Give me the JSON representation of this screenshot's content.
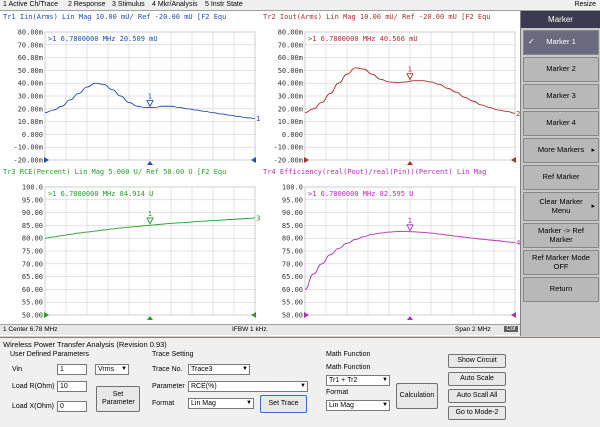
{
  "menu": {
    "items": [
      "1 Active Ch/Trace",
      "2 Response",
      "3 Stimulus",
      "4 Mkr/Analysis",
      "5 Instr State"
    ],
    "resize": "Resize"
  },
  "traces": [
    {
      "header": "Tr1 Iin(Arms) Lin Mag 10.00 mU/ Ref -20.00 mU [F2 Equ",
      "marker_text": ">1   6.7800000 MHz   20.509 mU",
      "color": "#1f4fa8",
      "yticks": [
        "80.00m",
        "70.00m",
        "60.00m",
        "50.00m",
        "40.00m",
        "30.00m",
        "20.00m",
        "10.00m",
        "0.000",
        "-10.00m",
        "-20.00m"
      ],
      "end_label": "1",
      "marker_label": "1",
      "values": [
        17,
        19,
        22,
        27,
        32,
        37,
        40,
        39,
        35,
        30,
        25,
        22,
        21,
        21,
        22,
        22,
        21,
        20,
        19,
        18,
        17,
        16,
        15,
        14,
        13,
        12.5
      ]
    },
    {
      "header": "Tr2 Iout(Arms) Lin Mag 10.00 mU/ Ref -20.00 mU [F2 Equ",
      "marker_text": ">1   6.7800000 MHz   40.566 mU",
      "color": "#a83030",
      "yticks": [
        "80.00m",
        "70.00m",
        "60.00m",
        "50.00m",
        "40.00m",
        "30.00m",
        "20.00m",
        "10.00m",
        "0.000",
        "-10.00m",
        "-20.00m"
      ],
      "end_label": "2",
      "marker_label": "1",
      "values": [
        17,
        20,
        25,
        32,
        40,
        47,
        52,
        51,
        47,
        43,
        41,
        40.5,
        41,
        42,
        42,
        41,
        39,
        36,
        33,
        29,
        26,
        23,
        21,
        19,
        18,
        16.5
      ]
    },
    {
      "header": "Tr3 RCE(Percent) Lin Mag 5.000 U/ Ref 50.00 U [F2 Equ",
      "marker_text": ">1   6.7800000 MHz   84.914 U",
      "color": "#2a9a2a",
      "yticks": [
        "100.0",
        "95.00",
        "90.00",
        "85.00",
        "80.00",
        "75.00",
        "70.00",
        "65.00",
        "60.00",
        "55.00",
        "50.00"
      ],
      "end_label": "3",
      "marker_label": "1",
      "values": [
        80,
        80.5,
        81,
        81.5,
        82,
        82.4,
        82.8,
        83.2,
        83.6,
        84,
        84.3,
        84.6,
        84.9,
        85.2,
        85.5,
        85.8,
        86,
        86.2,
        86.5,
        86.7,
        86.9,
        87.1,
        87.3,
        87.5,
        87.7,
        87.9
      ]
    },
    {
      "header": "Tr4 Efficiency(real(Pout)/real(Pin))(Percent) Lin Mag",
      "marker_text": ">1   6.7800000 MHz   82.595 U",
      "color": "#b030b0",
      "yticks": [
        "100.0",
        "95.00",
        "90.00",
        "85.00",
        "80.00",
        "75.00",
        "70.00",
        "65.00",
        "60.00",
        "55.00",
        "50.00"
      ],
      "end_label": "4",
      "marker_label": "1",
      "values": [
        60,
        66,
        70,
        73.5,
        76,
        78,
        79.5,
        80.6,
        81.5,
        82,
        82.4,
        82.6,
        82.6,
        82.5,
        82.3,
        82,
        81.6,
        81.2,
        80.8,
        80.4,
        80,
        79.6,
        79.3,
        79,
        78.6,
        78.3
      ]
    }
  ],
  "status": {
    "center": "1  Center  6.78 MHz",
    "ifbw": "IFBW 1 kHz",
    "span": "Span 2 MHz",
    "cor": "Cor"
  },
  "softkeys": {
    "title": "Marker",
    "items": [
      {
        "label": "Marker 1",
        "active": true
      },
      {
        "label": "Marker 2",
        "active": false
      },
      {
        "label": "Marker 3",
        "active": false
      },
      {
        "label": "Marker 4",
        "active": false
      },
      {
        "label": "More Markers",
        "active": false
      },
      {
        "label": "Ref Marker",
        "active": false
      },
      {
        "label": "Clear Marker Menu",
        "active": false
      },
      {
        "label": "Marker -> Ref Marker",
        "active": false
      },
      {
        "label": "Ref Marker Mode OFF",
        "active": false
      },
      {
        "label": "Return",
        "active": false
      }
    ]
  },
  "dialog": {
    "title": "Wireless Power Transfer Analysis  (Revision 0.93)",
    "user_params": {
      "group": "User Defined Parameters",
      "vin_label": "Vin",
      "vin_value": "1",
      "vin_unit": "Vrms",
      "loadr_label": "Load R(Ohm)",
      "loadr_value": "10",
      "loadx_label": "Load X(Ohm)",
      "loadx_value": "0",
      "set_param": "Set Parameter"
    },
    "trace_setting": {
      "group": "Trace Setting",
      "trace_no_label": "Trace No.",
      "trace_no_value": "Trace3",
      "param_label": "Parameter",
      "param_value": "RCE(%)",
      "format_label": "Format",
      "format_value": "Lin Mag",
      "set_trace": "Set Trace"
    },
    "math": {
      "group": "Math Function",
      "func_label": "Math Function",
      "func_value": "Tr1 + Tr2",
      "format_label": "Format",
      "format_value": "Lin Mag",
      "calc": "Calculation"
    },
    "right_buttons": [
      "Show Circuit",
      "Auto Scale",
      "Auto Scall All",
      "Go to Mode-2"
    ]
  }
}
